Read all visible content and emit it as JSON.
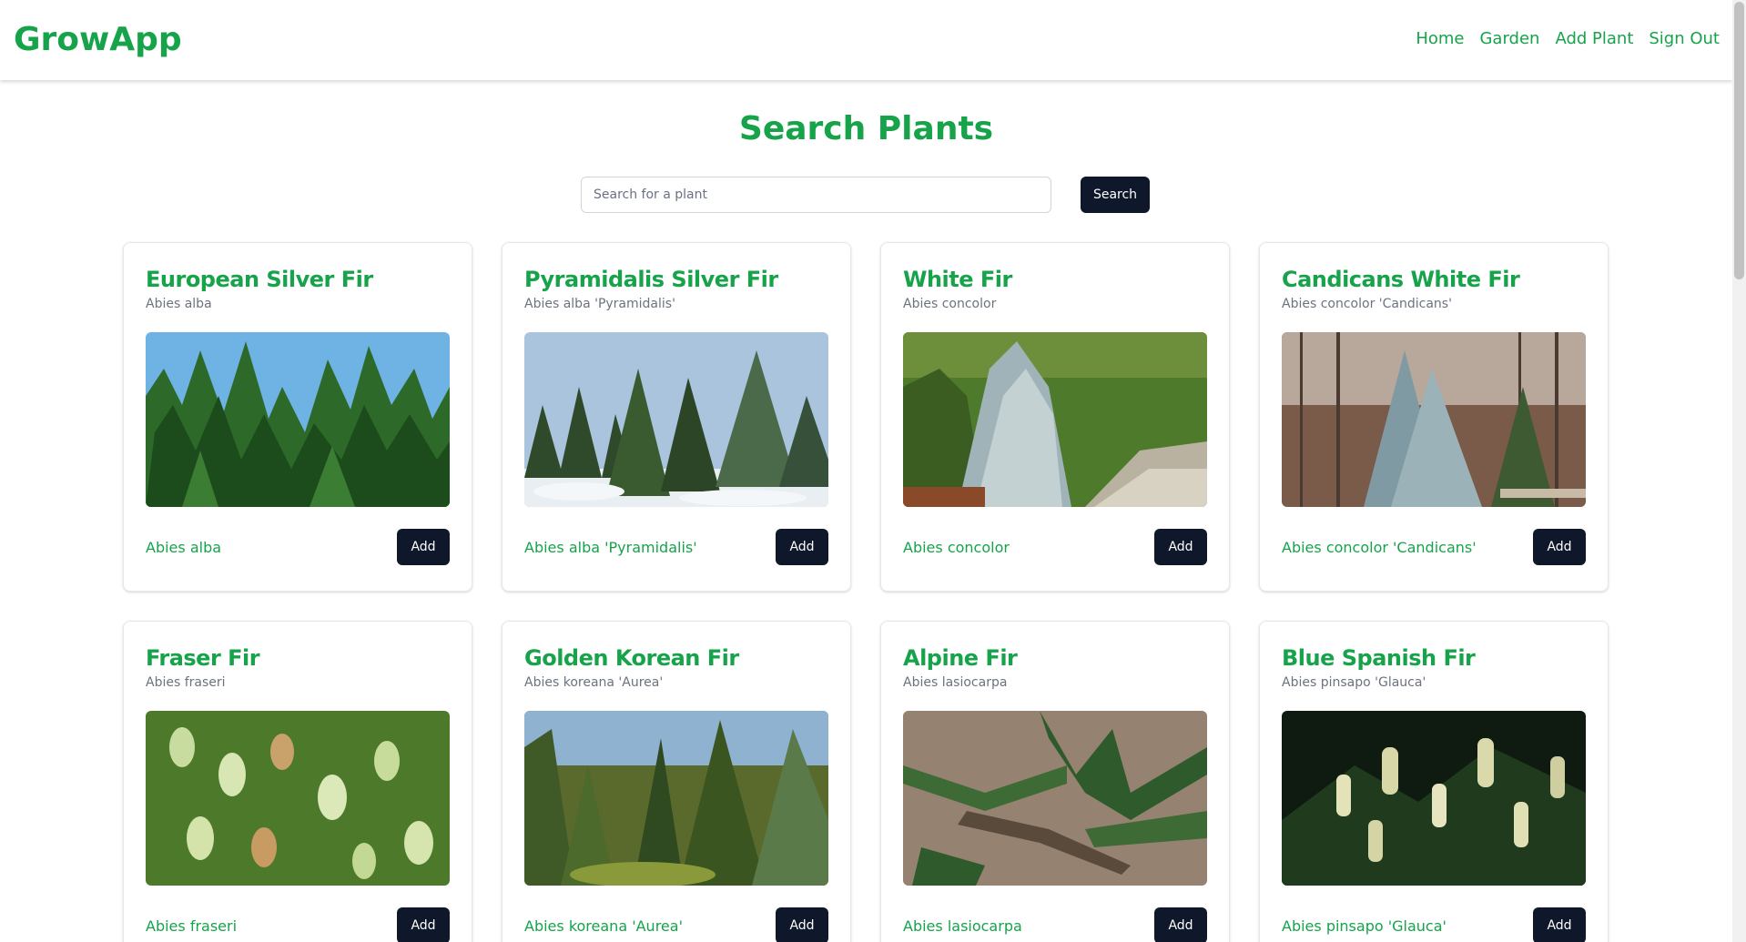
{
  "app": {
    "brand": "GrowApp"
  },
  "nav": {
    "items": [
      {
        "label": "Home"
      },
      {
        "label": "Garden"
      },
      {
        "label": "Add Plant"
      },
      {
        "label": "Sign Out"
      }
    ]
  },
  "search": {
    "title": "Search Plants",
    "placeholder": "Search for a plant",
    "value": "",
    "button_label": "Search"
  },
  "colors": {
    "brand": "#16a34a",
    "button": "#0f172a",
    "muted_text": "#6b7280"
  },
  "plants": [
    {
      "name": "European Silver Fir",
      "scientific": "Abies alba",
      "link": "Abies alba",
      "add_label": "Add",
      "image": "photo of tall green conifer trees against blue sky"
    },
    {
      "name": "Pyramidalis Silver Fir",
      "scientific": "Abies alba 'Pyramidalis'",
      "link": "Abies alba 'Pyramidalis'",
      "add_label": "Add",
      "image": "photo of conifers in a snowy garden"
    },
    {
      "name": "White Fir",
      "scientific": "Abies concolor",
      "link": "Abies concolor",
      "add_label": "Add",
      "image": "photo of blue-grey fir beside a garden path"
    },
    {
      "name": "Candicans White Fir",
      "scientific": "Abies concolor 'Candicans'",
      "link": "Abies concolor 'Candicans'",
      "add_label": "Add",
      "image": "photo of silvery fir in bare winter woodland"
    },
    {
      "name": "Fraser Fir",
      "scientific": "Abies fraseri",
      "link": "Abies fraseri",
      "add_label": "Add",
      "image": "close-up photo of fir cones on branches"
    },
    {
      "name": "Golden Korean Fir",
      "scientific": "Abies koreana 'Aurea'",
      "link": "Abies koreana 'Aurea'",
      "add_label": "Add",
      "image": "photo of golden-green conifers in a park"
    },
    {
      "name": "Alpine Fir",
      "scientific": "Abies lasiocarpa",
      "link": "Abies lasiocarpa",
      "add_label": "Add",
      "image": "close-up photo of fir needles over leaf litter"
    },
    {
      "name": "Blue Spanish Fir",
      "scientific": "Abies pinsapo 'Glauca'",
      "link": "Abies pinsapo 'Glauca'",
      "add_label": "Add",
      "image": "close-up photo of pale cones on dark branches"
    }
  ]
}
